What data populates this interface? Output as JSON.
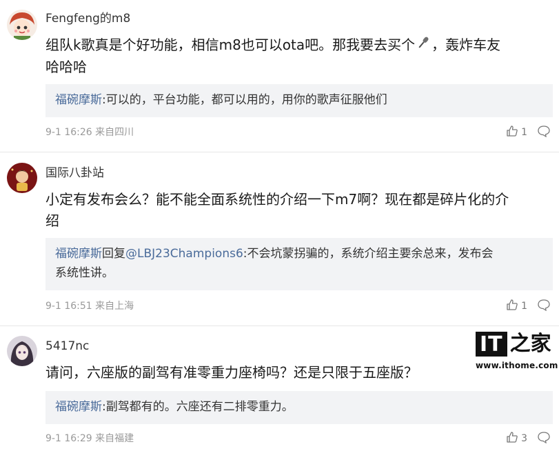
{
  "comments": [
    {
      "username": "Fengfeng的m8",
      "text_before_icon": "组队k歌真是个好功能，相信m8也可以ota吧。那我要去买个",
      "text_icon": "microphone-icon",
      "text_after_icon": "，轰炸车友",
      "text_line2": "哈哈哈",
      "reply": {
        "author": "福碗摩斯",
        "content": ":可以的，平台功能，都可以用的，用你的歌声征服他们"
      },
      "meta": "9-1 16:26 来自四川",
      "likes": "1"
    },
    {
      "username": "国际八卦站",
      "text_line1": "小定有发布会么？能不能全面系统性的介绍一下m7啊？现在都是碎片化的介",
      "text_line2": "绍",
      "reply": {
        "author": "福碗摩斯",
        "reply_word": "回复",
        "mention": "@LBJ23Champions6",
        "content_line1": ":不会坑蒙拐骗的，系统介绍主要余总来，发布会",
        "content_line2": "系统性讲。"
      },
      "meta": "9-1 16:51 来自上海",
      "likes": "1"
    },
    {
      "username": "5417nc",
      "text_line1": "请问，六座版的副驾有准零重力座椅吗？还是只限于五座版？",
      "reply": {
        "author": "福碗摩斯",
        "content": ":副驾都有的。六座还有二排零重力。"
      },
      "meta": "9-1 16:29 来自福建",
      "likes": "3"
    }
  ],
  "watermark": {
    "logo_latin": "IT",
    "logo_cn": "之家",
    "url": "www.ithome.com"
  },
  "icons": {
    "like": "thumbs-up-icon",
    "reply": "speech-bubble-icon",
    "avatar": "avatar"
  },
  "colors": {
    "reply_author": "#4a6b9a",
    "reply_background": "#f2f3f5",
    "meta_text": "#999999"
  }
}
